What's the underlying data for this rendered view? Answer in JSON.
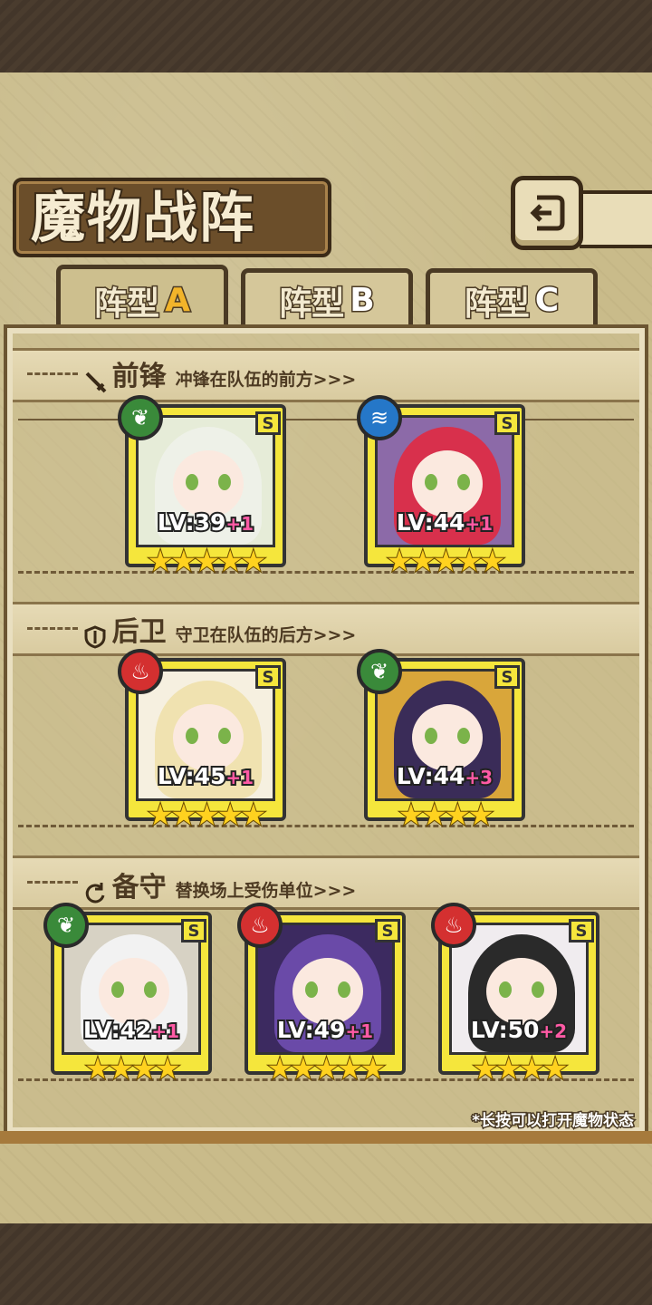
{
  "title": "魔物战阵",
  "tabs": [
    {
      "label": "阵型",
      "suffix": "A",
      "active": true
    },
    {
      "label": "阵型",
      "suffix": "B",
      "active": false
    },
    {
      "label": "阵型",
      "suffix": "C",
      "active": false
    }
  ],
  "sections": [
    {
      "name": "前锋",
      "desc": "冲锋在队伍的前方>>>",
      "icon": "sword-icon"
    },
    {
      "name": "后卫",
      "desc": "守卫在队伍的后方>>>",
      "icon": "shield-icon"
    },
    {
      "name": "备守",
      "desc": "替换场上受伤单位>>>",
      "icon": "swap-icon"
    }
  ],
  "cards": [
    {
      "section": 0,
      "lv": "LV:39",
      "plus": "+1",
      "stars": 5,
      "rank": "S",
      "element": "nature",
      "hair": "#eef1e8",
      "bg": "#e6ecd8"
    },
    {
      "section": 0,
      "lv": "LV:44",
      "plus": "+1",
      "stars": 5,
      "rank": "S",
      "element": "water",
      "hair": "#d8304c",
      "bg": "#8c6aa8"
    },
    {
      "section": 1,
      "lv": "LV:45",
      "plus": "+1",
      "stars": 5,
      "rank": "S",
      "element": "fire",
      "hair": "#f0e2b0",
      "bg": "#f6f0e0"
    },
    {
      "section": 1,
      "lv": "LV:44",
      "plus": "+3",
      "stars": 4,
      "rank": "S",
      "element": "nature",
      "hair": "#3a2c58",
      "bg": "#d9a63a"
    },
    {
      "section": 2,
      "lv": "LV:42",
      "plus": "+1",
      "stars": 4,
      "rank": "S",
      "element": "nature",
      "hair": "#f2f2f2",
      "bg": "#d7d2c4"
    },
    {
      "section": 2,
      "lv": "LV:49",
      "plus": "+1",
      "stars": 5,
      "rank": "S",
      "element": "fire",
      "hair": "#6a4aa8",
      "bg": "#3c2a60"
    },
    {
      "section": 2,
      "lv": "LV:50",
      "plus": "+2",
      "stars": 4,
      "rank": "S",
      "element": "fire",
      "hair": "#2a2a2a",
      "bg": "#f0ecef"
    }
  ],
  "hint": "*长按可以打开魔物状态",
  "colors": {
    "accent": "#f5e63c",
    "plus": "#ff5aa5",
    "star": "#ffd21f"
  }
}
